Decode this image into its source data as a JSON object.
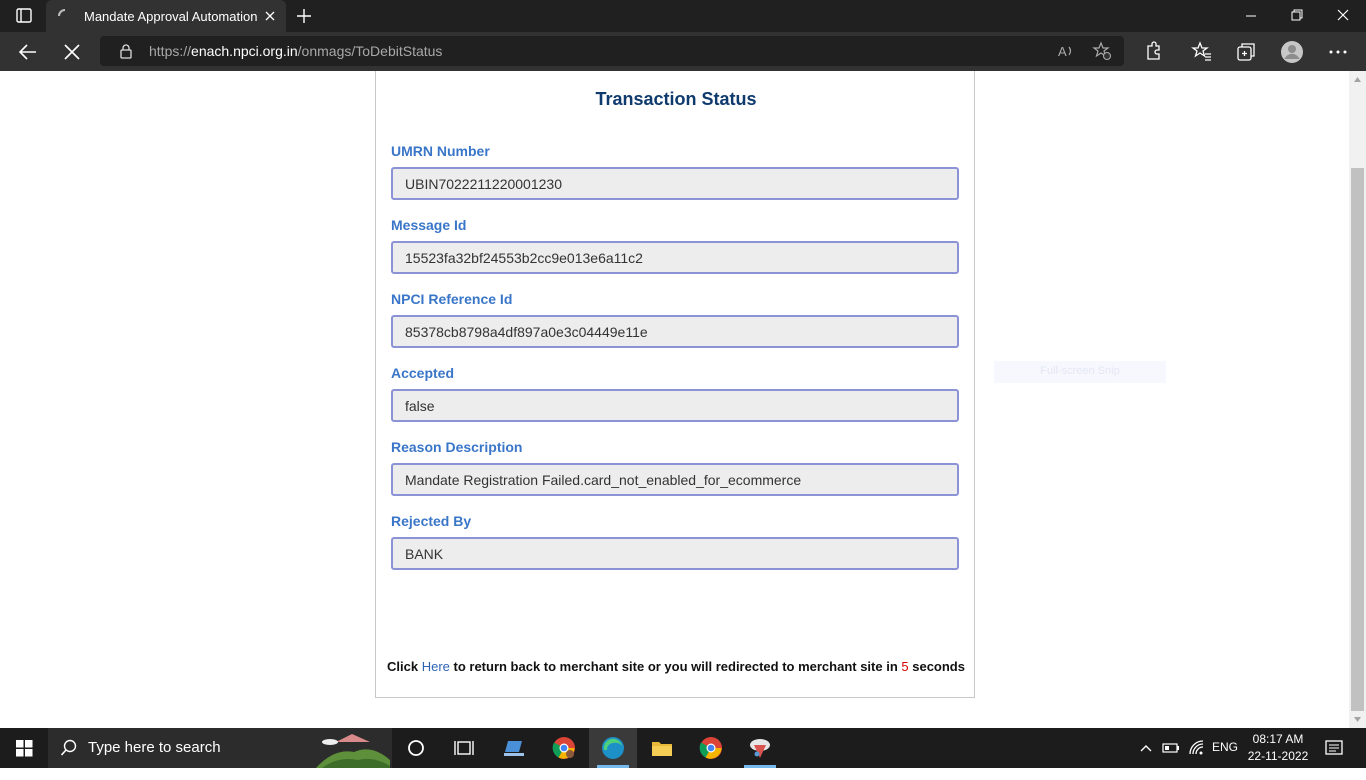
{
  "browser": {
    "tab_title": "Mandate Approval Automation",
    "url_prefix": "https://",
    "url_domain": "enach.npci.org.in",
    "url_path": "/onmags/ToDebitStatus"
  },
  "page": {
    "heading": "Transaction Status",
    "fields": [
      {
        "label": "UMRN Number",
        "value": "UBIN7022211220001230"
      },
      {
        "label": "Message Id",
        "value": "15523fa32bf24553b2cc9e013e6a11c2"
      },
      {
        "label": "NPCI Reference Id",
        "value": "85378cb8798a4df897a0e3c04449e11e"
      },
      {
        "label": "Accepted",
        "value": "false"
      },
      {
        "label": "Reason Description",
        "value": "Mandate Registration Failed.card_not_enabled_for_ecommerce"
      },
      {
        "label": "Rejected By",
        "value": "BANK"
      }
    ],
    "footer": {
      "prefix": "Click ",
      "link": "Here",
      "middle": " to return back to merchant site or you will redirected to merchant site in ",
      "count": "5",
      "suffix": " seconds"
    },
    "ghost_button": "Full-screen Snip"
  },
  "taskbar": {
    "search_placeholder": "Type here to search",
    "language": "ENG",
    "time": "08:17 AM",
    "date": "22-11-2022"
  },
  "colors": {
    "heading": "#0f3a6e",
    "label": "#3a76c8",
    "field_border": "#8b93d6",
    "countdown": "#d40000",
    "link": "#2f64b5"
  }
}
